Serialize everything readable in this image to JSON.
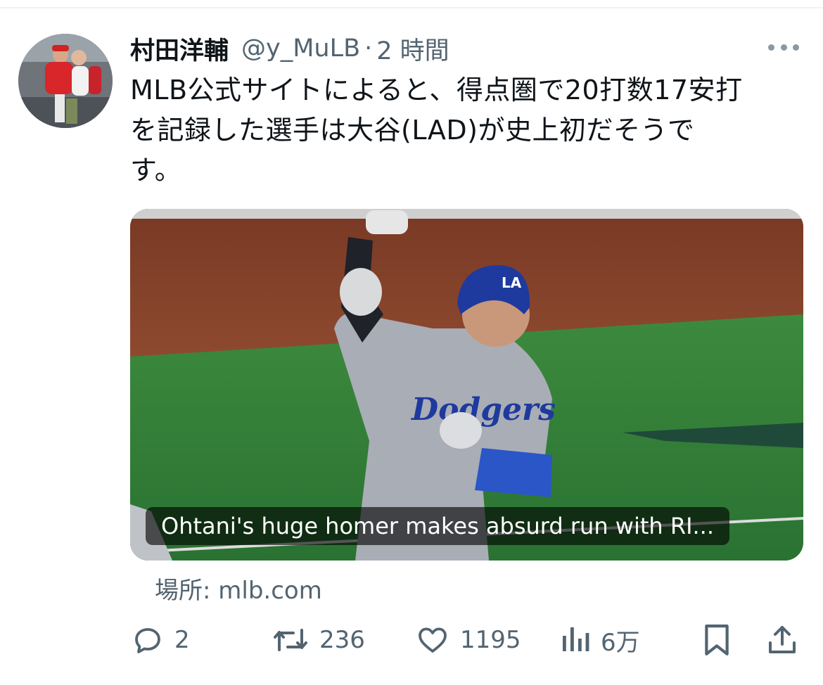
{
  "author": {
    "display_name": "村田洋輔",
    "handle": "@y_MuLB",
    "separator": "·",
    "time": "2 時間"
  },
  "tweet": {
    "text": "MLB公式サイトによると、得点圏で20打数17安打\nを記録した選手は大谷(LAD)が史上初だそうで\nす。"
  },
  "card": {
    "caption": "Ohtani's huge homer makes absurd run with RI..."
  },
  "source_label": "場所: mlb.com",
  "actions": {
    "replies": "2",
    "retweets": "236",
    "likes": "1195",
    "views": "6万"
  },
  "icons": {
    "more": "more-horizontal-icon",
    "reply": "speech-bubble-icon",
    "retweet": "retweet-icon",
    "like": "heart-icon",
    "views": "bar-chart-icon",
    "bookmark": "bookmark-icon",
    "share": "share-icon"
  },
  "colors": {
    "text_primary": "#0f1419",
    "text_secondary": "#536471",
    "caption_bg": "#000000"
  }
}
